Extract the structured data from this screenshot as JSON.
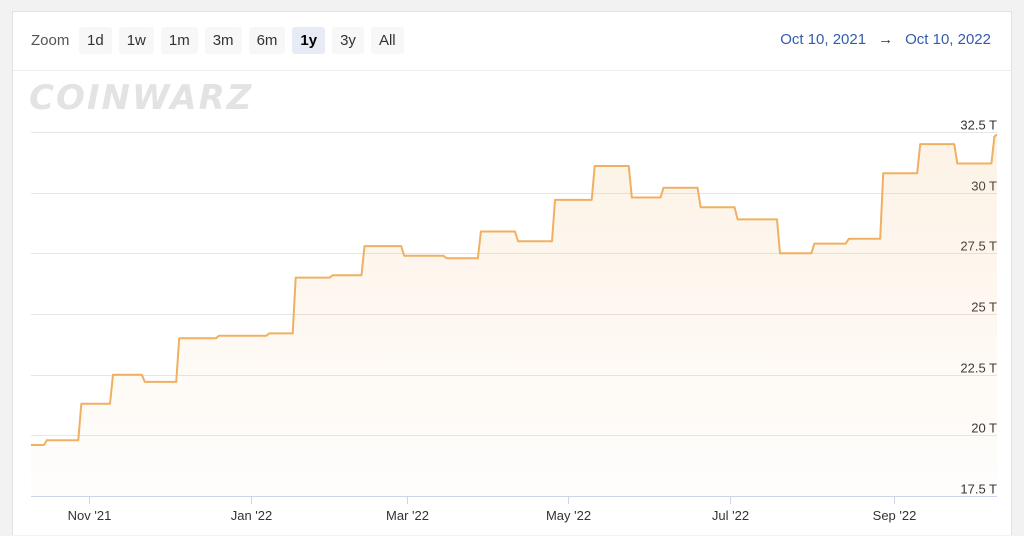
{
  "zoom": {
    "label": "Zoom",
    "buttons": [
      {
        "label": "1d",
        "active": false
      },
      {
        "label": "1w",
        "active": false
      },
      {
        "label": "1m",
        "active": false
      },
      {
        "label": "3m",
        "active": false
      },
      {
        "label": "6m",
        "active": false
      },
      {
        "label": "1y",
        "active": true
      },
      {
        "label": "3y",
        "active": false
      },
      {
        "label": "All",
        "active": false
      }
    ]
  },
  "range": {
    "from": "Oct 10, 2021",
    "arrow": "→",
    "to": "Oct 10, 2022"
  },
  "watermark": "COINWARZ",
  "colors": {
    "line": "#f0b062",
    "grid": "#e6e6e6",
    "range_text": "#335cad",
    "axis_line": "#ccd6eb"
  },
  "chart_data": {
    "type": "area",
    "step": true,
    "x_unit": "date",
    "xlim": [
      "2021-10-10",
      "2022-10-10"
    ],
    "ylim": [
      17.5,
      32.5
    ],
    "y_ticks": [
      17.5,
      20,
      22.5,
      25,
      27.5,
      30,
      32.5
    ],
    "y_tick_labels": [
      "17.5 T",
      "20 T",
      "22.5 T",
      "25 T",
      "27.5 T",
      "30 T",
      "32.5 T"
    ],
    "x_ticks": [
      "2021-11-01",
      "2022-01-01",
      "2022-03-01",
      "2022-05-01",
      "2022-07-01",
      "2022-09-01"
    ],
    "x_tick_labels": [
      "Nov '21",
      "Jan '22",
      "Mar '22",
      "May '22",
      "Jul '22",
      "Sep '22"
    ],
    "grid": true,
    "series": [
      {
        "points": [
          [
            "2021-10-10",
            19.6
          ],
          [
            "2021-10-16",
            19.8
          ],
          [
            "2021-10-29",
            21.3
          ],
          [
            "2021-11-10",
            22.5
          ],
          [
            "2021-11-22",
            22.2
          ],
          [
            "2021-12-05",
            24.0
          ],
          [
            "2021-12-20",
            24.1
          ],
          [
            "2022-01-08",
            24.2
          ],
          [
            "2022-01-18",
            26.5
          ],
          [
            "2022-02-01",
            26.6
          ],
          [
            "2022-02-13",
            27.8
          ],
          [
            "2022-02-28",
            27.4
          ],
          [
            "2022-03-16",
            27.3
          ],
          [
            "2022-03-29",
            28.4
          ],
          [
            "2022-04-12",
            28.0
          ],
          [
            "2022-04-26",
            29.7
          ],
          [
            "2022-05-11",
            31.1
          ],
          [
            "2022-05-25",
            29.8
          ],
          [
            "2022-06-06",
            30.2
          ],
          [
            "2022-06-20",
            29.4
          ],
          [
            "2022-07-04",
            28.9
          ],
          [
            "2022-07-20",
            27.5
          ],
          [
            "2022-08-02",
            27.9
          ],
          [
            "2022-08-15",
            28.1
          ],
          [
            "2022-08-28",
            30.8
          ],
          [
            "2022-09-11",
            32.0
          ],
          [
            "2022-09-25",
            31.2
          ],
          [
            "2022-10-09",
            32.3
          ],
          [
            "2022-10-10",
            32.4
          ]
        ]
      }
    ]
  }
}
